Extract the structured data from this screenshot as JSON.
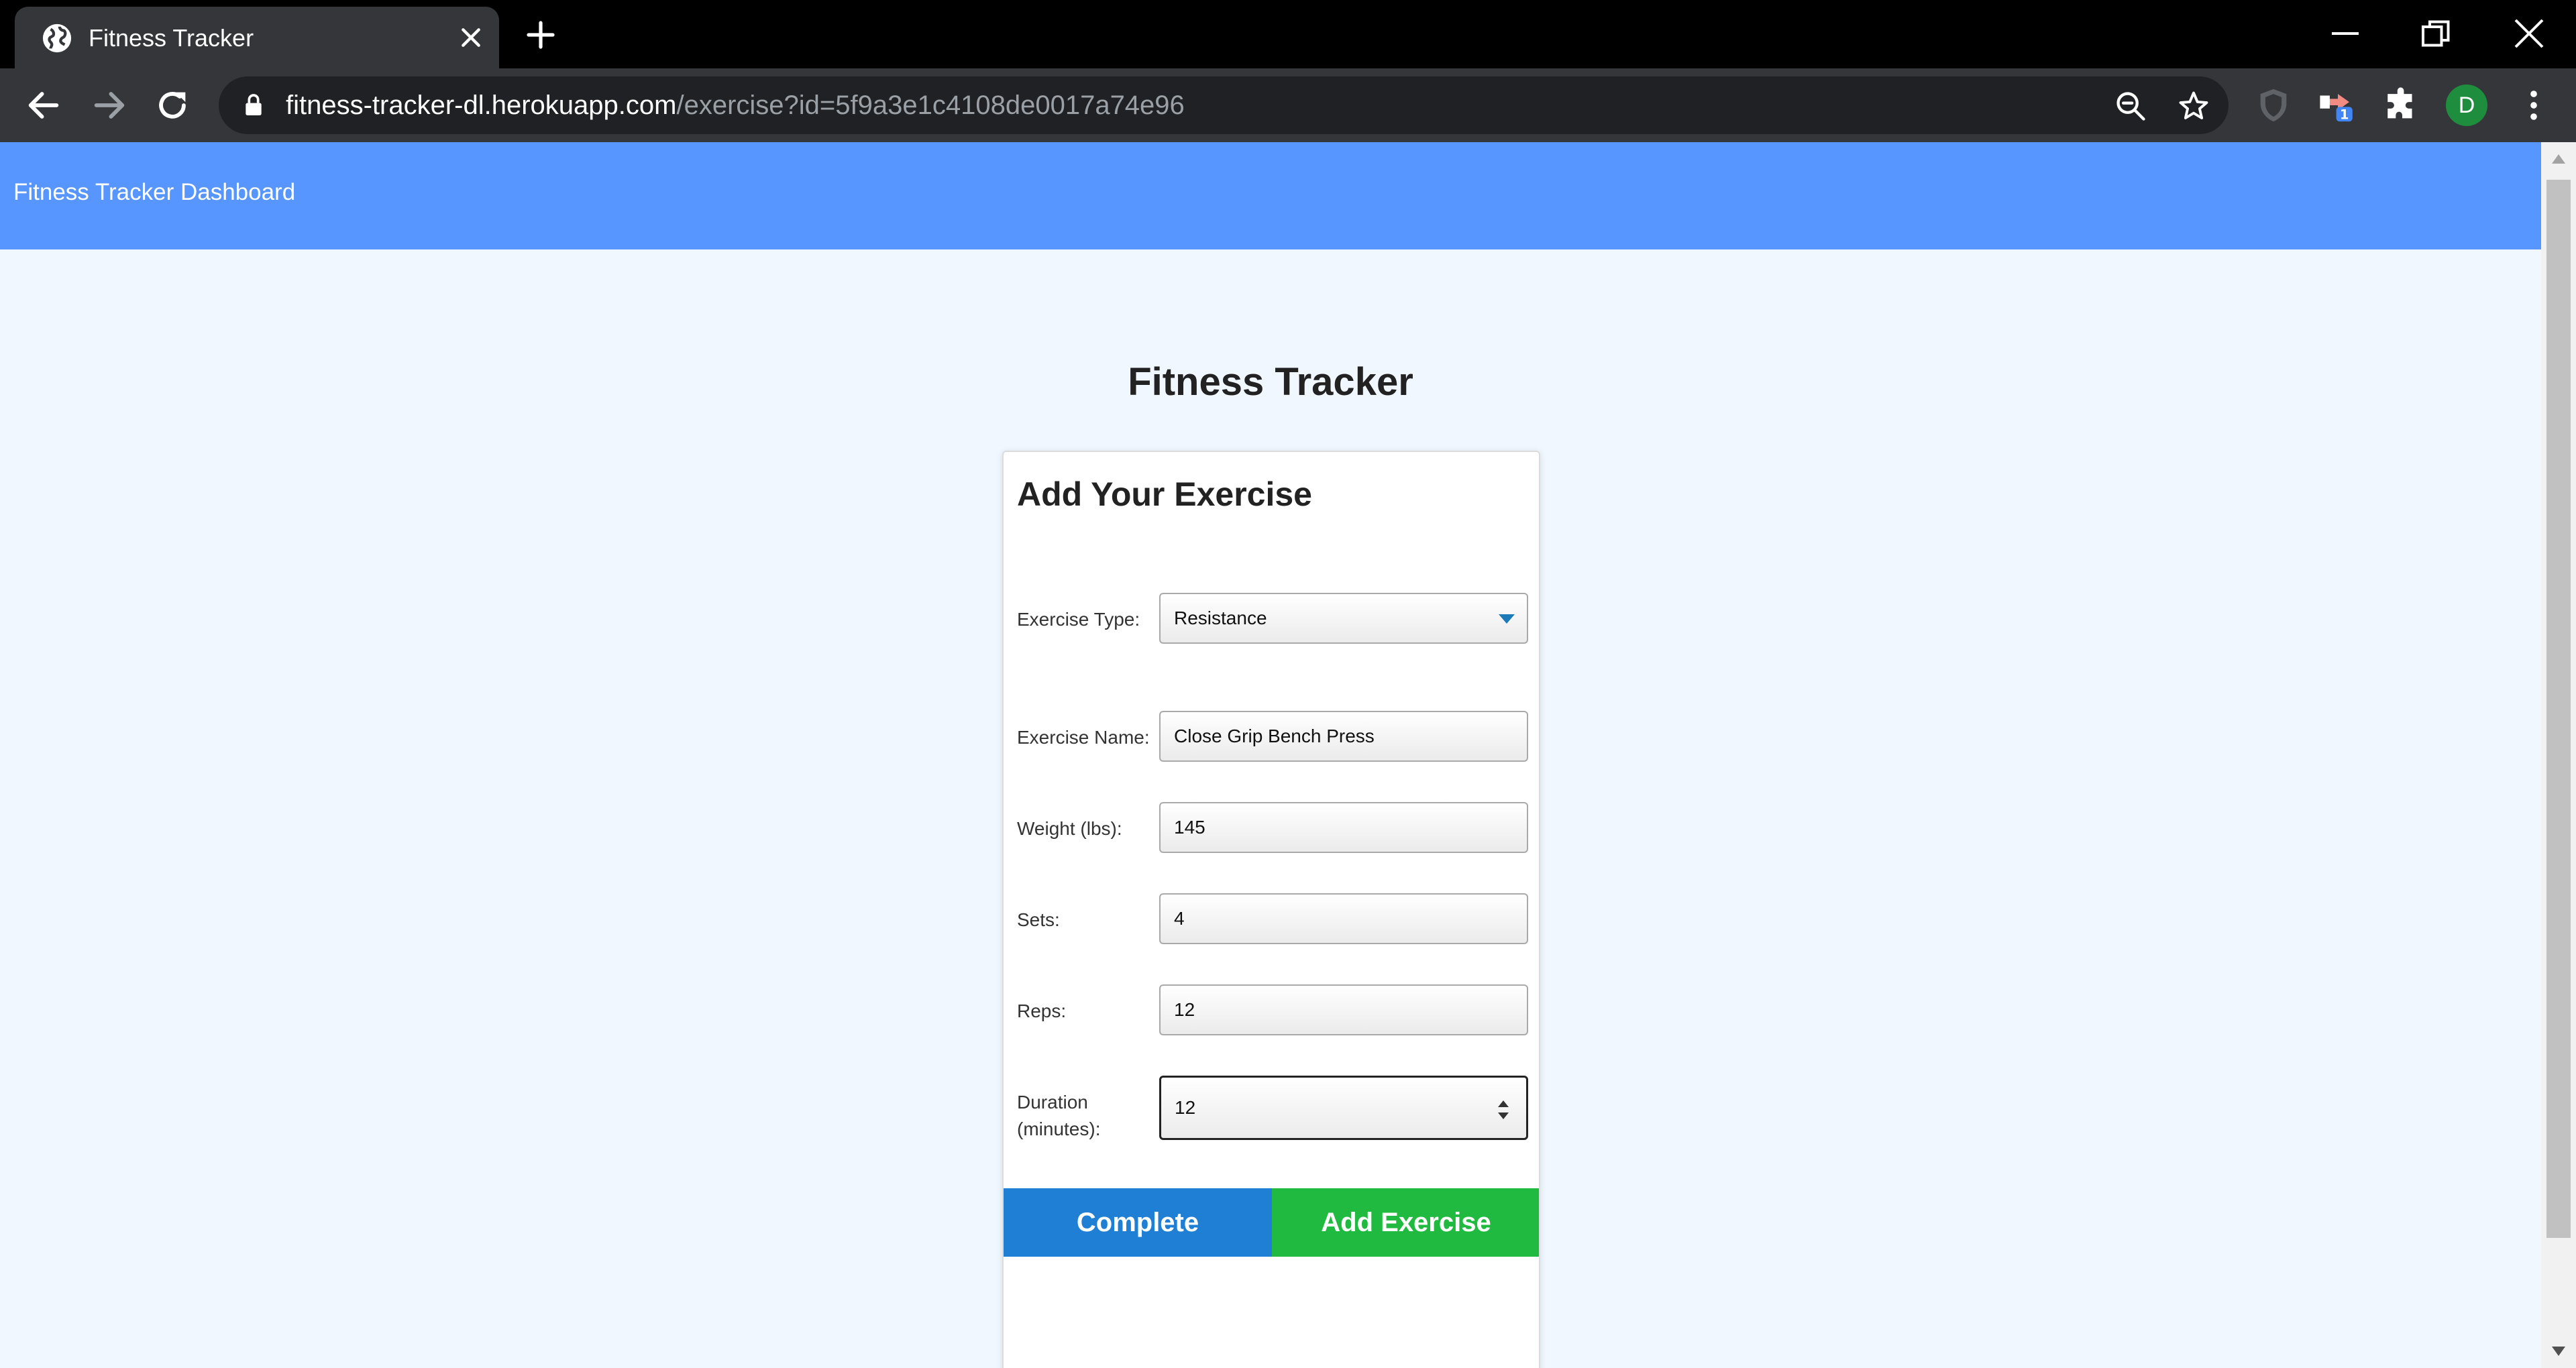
{
  "browser": {
    "tab_title": "Fitness Tracker",
    "url_host": "fitness-tracker-dl.herokuapp.com",
    "url_path": "/exercise?id=5f9a3e1c4108de0017a74e96",
    "extension_badge": "1",
    "profile_initial": "D"
  },
  "navbar": {
    "brand": "Fitness Tracker Dashboard"
  },
  "page": {
    "title": "Fitness Tracker"
  },
  "form": {
    "heading": "Add Your Exercise",
    "exercise_type": {
      "label": "Exercise Type:",
      "value": "Resistance"
    },
    "exercise_name": {
      "label": "Exercise Name:",
      "value": "Close Grip Bench Press"
    },
    "weight": {
      "label": "Weight (lbs):",
      "value": "145"
    },
    "sets": {
      "label": "Sets:",
      "value": "4"
    },
    "reps": {
      "label": "Reps:",
      "value": "12"
    },
    "duration": {
      "label_line1": "Duration",
      "label_line2": "(minutes):",
      "value": "12"
    },
    "complete_label": "Complete",
    "add_label": "Add Exercise"
  },
  "colors": {
    "navbar": "#5795ff",
    "complete": "#1f7fd4",
    "add": "#1fba3f",
    "page_bg": "#f0f7ff"
  }
}
